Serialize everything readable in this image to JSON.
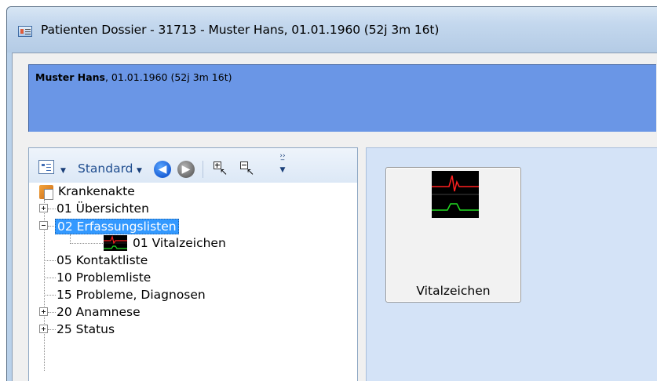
{
  "window": {
    "title": "Patienten Dossier - 31713 - Muster Hans, 01.01.1960 (52j 3m 16t)"
  },
  "patient_header": {
    "name": "Muster Hans",
    "details": ", 01.01.1960 (52j 3m 16t)"
  },
  "toolbar": {
    "view_selector_icon": "tree-view-icon",
    "standard_label": "Standard",
    "back_icon": "back-arrow-icon",
    "forward_icon": "forward-arrow-icon",
    "expand_icon": "expand-all-icon",
    "collapse_icon": "collapse-all-icon"
  },
  "tree": {
    "root": "Krankenakte",
    "items": [
      {
        "label": "01 Übersichten",
        "expandable": true,
        "expanded": false
      },
      {
        "label": "02 Erfassungslisten",
        "expandable": true,
        "expanded": true,
        "selected": true
      },
      {
        "label": "01 Vitalzeichen",
        "child": true
      },
      {
        "label": "05 Kontaktliste"
      },
      {
        "label": "10 Problemliste"
      },
      {
        "label": "15 Probleme, Diagnosen"
      },
      {
        "label": "20 Anamnese",
        "expandable": true,
        "expanded": false
      },
      {
        "label": "25 Status",
        "expandable": true,
        "expanded": false
      }
    ]
  },
  "tiles": [
    {
      "label": "Vitalzeichen",
      "icon": "vital-signs-icon"
    }
  ],
  "colors": {
    "header_bg": "#6a96e6",
    "selection": "#3399ff",
    "vital_red": "#ff2020",
    "vital_green": "#22dd22"
  }
}
